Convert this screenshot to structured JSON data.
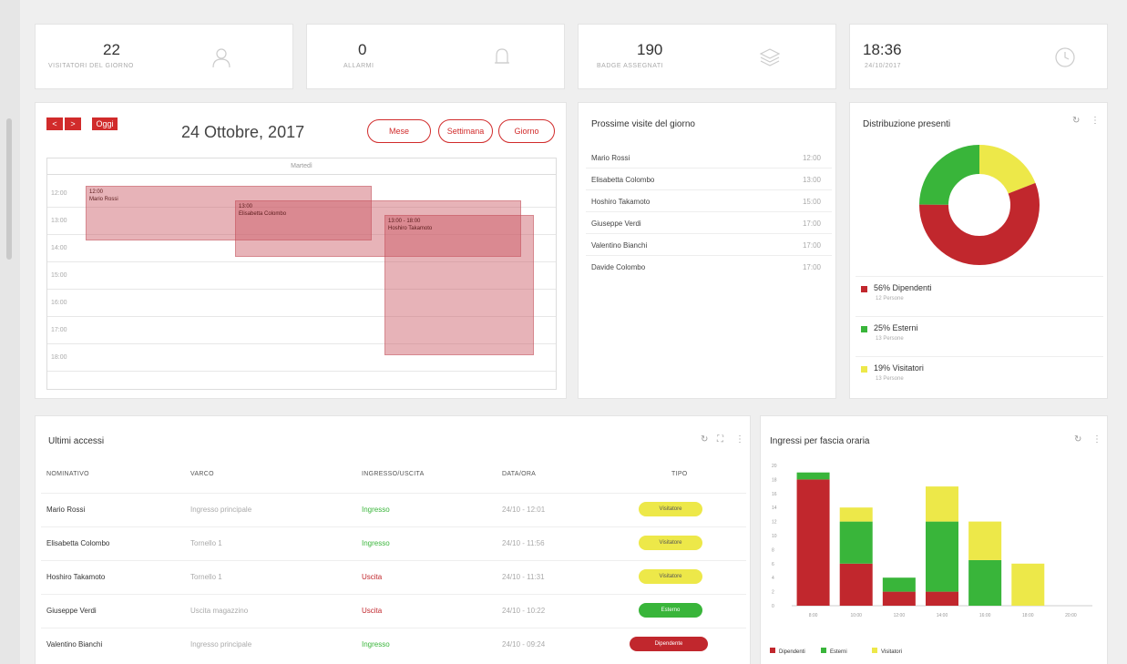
{
  "kpis": [
    {
      "value": "22",
      "label": "VISITATORI DEL GIORNO",
      "icon": "user-icon"
    },
    {
      "value": "0",
      "label": "ALLARMI",
      "icon": "bell-icon"
    },
    {
      "value": "190",
      "label": "BADGE ASSEGNATI",
      "icon": "layers-icon"
    },
    {
      "value": "18:36",
      "label": "24/10/2017",
      "icon": "clock-icon"
    }
  ],
  "calendar": {
    "prev": "<",
    "next": ">",
    "today": "Oggi",
    "date": "24 Ottobre, 2017",
    "views": [
      "Mese",
      "Settimana",
      "Giorno"
    ],
    "day_header": "Martedì",
    "times": [
      "12:00",
      "13:00",
      "14:00",
      "15:00",
      "16:00",
      "17:00",
      "18:00"
    ],
    "events": [
      {
        "time": "12:00",
        "name": "Mario Rossi"
      },
      {
        "time": "13:00",
        "name": "Elisabetta Colombo"
      },
      {
        "time": "13:00 - 18:00",
        "name": "Hoshiro Takamoto"
      }
    ]
  },
  "visits": {
    "title": "Prossime visite del giorno",
    "rows": [
      {
        "name": "Mario Rossi",
        "time": "12:00"
      },
      {
        "name": "Elisabetta Colombo",
        "time": "13:00"
      },
      {
        "name": "Hoshiro Takamoto",
        "time": "15:00"
      },
      {
        "name": "Giuseppe Verdi",
        "time": "17:00"
      },
      {
        "name": "Valentino Bianchi",
        "time": "17:00"
      },
      {
        "name": "Davide Colombo",
        "time": "17:00"
      }
    ]
  },
  "distribution": {
    "title": "Distribuzione presenti",
    "refresh_icon": "refresh-icon",
    "colors": {
      "red": "#c1272d",
      "green": "#39b53a",
      "yellow": "#ede849"
    },
    "legend": [
      {
        "label": "56% Dipendenti",
        "sub": "12 Persone",
        "color": "#c1272d"
      },
      {
        "label": "25% Esterni",
        "sub": "13 Persone",
        "color": "#39b53a"
      },
      {
        "label": "19% Visitatori",
        "sub": "13 Persone",
        "color": "#ede849"
      }
    ]
  },
  "access": {
    "title": "Ultimi accessi",
    "headers": [
      "NOMINATIVO",
      "VARCO",
      "INGRESSO/USCITA",
      "DATA/ORA",
      "TIPO"
    ],
    "rows": [
      {
        "name": "Mario Rossi",
        "gate": "Ingresso principale",
        "dir": "Ingresso",
        "dt": "24/10 - 12:01",
        "type": "Visitatore",
        "kind": "yellow"
      },
      {
        "name": "Elisabetta Colombo",
        "gate": "Tornello 1",
        "dir": "Ingresso",
        "dt": "24/10 - 11:56",
        "type": "Visitatore",
        "kind": "yellow"
      },
      {
        "name": "Hoshiro Takamoto",
        "gate": "Tornello 1",
        "dir": "Uscita",
        "dt": "24/10 - 11:31",
        "type": "Visitatore",
        "kind": "yellow"
      },
      {
        "name": "Giuseppe Verdi",
        "gate": "Uscita magazzino",
        "dir": "Uscita",
        "dt": "24/10 - 10:22",
        "type": "Esterno",
        "kind": "green"
      },
      {
        "name": "Valentino Bianchi",
        "gate": "Ingresso principale",
        "dir": "Ingresso",
        "dt": "24/10 - 09:24",
        "type": "Dipendente",
        "kind": "red"
      }
    ]
  },
  "hourly": {
    "title": "Ingressi per fascia oraria",
    "legend": [
      "Dipendenti",
      "Esterni",
      "Visitatori"
    ]
  },
  "chart_data": {
    "type": "bar",
    "title": "Ingressi per fascia oraria",
    "categories": [
      "8:00",
      "10:00",
      "12:00",
      "14:00",
      "16:00",
      "18:00",
      "20:00"
    ],
    "series": [
      {
        "name": "Dipendenti",
        "color": "#c1272d",
        "values": [
          18,
          6,
          2,
          2,
          0,
          0,
          0
        ]
      },
      {
        "name": "Esterni",
        "color": "#39b53a",
        "values": [
          1,
          6,
          2,
          10,
          6.5,
          0,
          0
        ]
      },
      {
        "name": "Visitatori",
        "color": "#ede849",
        "values": [
          0,
          2,
          0,
          5,
          5.5,
          6,
          0
        ]
      }
    ],
    "y_ticks": [
      "0",
      "2",
      "4",
      "6",
      "8",
      "10",
      "12",
      "14",
      "16",
      "18",
      "20"
    ],
    "ylim": [
      0,
      20
    ],
    "stacked": true,
    "legend_position": "bottom-left"
  }
}
